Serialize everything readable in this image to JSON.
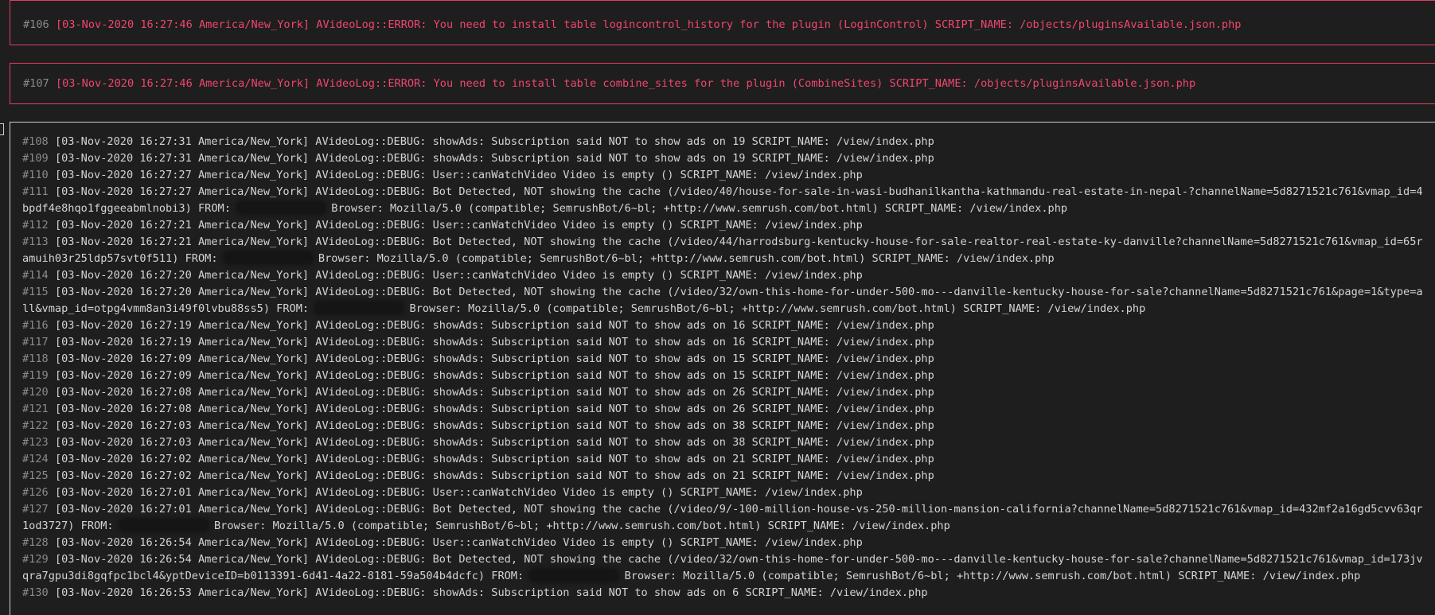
{
  "errors": [
    {
      "num": "#106",
      "text": "[03-Nov-2020 16:27:46 America/New_York] AVideoLog::ERROR: You need to install table logincontrol_history for the plugin (LoginControl) SCRIPT_NAME: /objects/pluginsAvailable.json.php"
    },
    {
      "num": "#107",
      "text": "[03-Nov-2020 16:27:46 America/New_York] AVideoLog::ERROR: You need to install table combine_sites for the plugin (CombineSites) SCRIPT_NAME: /objects/pluginsAvailable.json.php"
    }
  ],
  "debug_lines": [
    {
      "num": "#108",
      "text": "[03-Nov-2020 16:27:31 America/New_York] AVideoLog::DEBUG: showAds: Subscription said NOT to show ads on 19 SCRIPT_NAME: /view/index.php"
    },
    {
      "num": "#109",
      "text": "[03-Nov-2020 16:27:31 America/New_York] AVideoLog::DEBUG: showAds: Subscription said NOT to show ads on 19 SCRIPT_NAME: /view/index.php"
    },
    {
      "num": "#110",
      "text": "[03-Nov-2020 16:27:27 America/New_York] AVideoLog::DEBUG: User::canWatchVideo Video is empty () SCRIPT_NAME: /view/index.php"
    },
    {
      "num": "#111",
      "text": "[03-Nov-2020 16:27:27 America/New_York] AVideoLog::DEBUG: Bot Detected, NOT showing the cache (/video/40/house-for-sale-in-wasi-budhanilkantha-kathmandu-real-estate-in-nepal-?channelName=5d8271521c761&vmap_id=4bpdf4e8hqo1fggeeabmlnobi3) FROM:",
      "redacted": true,
      "text2": "Browser: Mozilla/5.0 (compatible; SemrushBot/6~bl; +http://www.semrush.com/bot.html) SCRIPT_NAME: /view/index.php"
    },
    {
      "num": "#112",
      "text": "[03-Nov-2020 16:27:21 America/New_York] AVideoLog::DEBUG: User::canWatchVideo Video is empty () SCRIPT_NAME: /view/index.php"
    },
    {
      "num": "#113",
      "text": "[03-Nov-2020 16:27:21 America/New_York] AVideoLog::DEBUG: Bot Detected, NOT showing the cache (/video/44/harrodsburg-kentucky-house-for-sale-realtor-real-estate-ky-danville?channelName=5d8271521c761&vmap_id=65ramuih03r25ldp57svt0f511) FROM:",
      "redacted": true,
      "text2": "Browser: Mozilla/5.0 (compatible; SemrushBot/6~bl; +http://www.semrush.com/bot.html) SCRIPT_NAME: /view/index.php"
    },
    {
      "num": "#114",
      "text": "[03-Nov-2020 16:27:20 America/New_York] AVideoLog::DEBUG: User::canWatchVideo Video is empty () SCRIPT_NAME: /view/index.php"
    },
    {
      "num": "#115",
      "text": "[03-Nov-2020 16:27:20 America/New_York] AVideoLog::DEBUG: Bot Detected, NOT showing the cache (/video/32/own-this-home-for-under-500-mo---danville-kentucky-house-for-sale?channelName=5d8271521c761&page=1&type=all&vmap_id=otpg4vmm8an3i49f0lvbu88ss5) FROM:",
      "redacted": true,
      "text2": "Browser: Mozilla/5.0 (compatible; SemrushBot/6~bl; +http://www.semrush.com/bot.html) SCRIPT_NAME: /view/index.php"
    },
    {
      "num": "#116",
      "text": "[03-Nov-2020 16:27:19 America/New_York] AVideoLog::DEBUG: showAds: Subscription said NOT to show ads on 16 SCRIPT_NAME: /view/index.php"
    },
    {
      "num": "#117",
      "text": "[03-Nov-2020 16:27:19 America/New_York] AVideoLog::DEBUG: showAds: Subscription said NOT to show ads on 16 SCRIPT_NAME: /view/index.php"
    },
    {
      "num": "#118",
      "text": "[03-Nov-2020 16:27:09 America/New_York] AVideoLog::DEBUG: showAds: Subscription said NOT to show ads on 15 SCRIPT_NAME: /view/index.php"
    },
    {
      "num": "#119",
      "text": "[03-Nov-2020 16:27:09 America/New_York] AVideoLog::DEBUG: showAds: Subscription said NOT to show ads on 15 SCRIPT_NAME: /view/index.php"
    },
    {
      "num": "#120",
      "text": "[03-Nov-2020 16:27:08 America/New_York] AVideoLog::DEBUG: showAds: Subscription said NOT to show ads on 26 SCRIPT_NAME: /view/index.php"
    },
    {
      "num": "#121",
      "text": "[03-Nov-2020 16:27:08 America/New_York] AVideoLog::DEBUG: showAds: Subscription said NOT to show ads on 26 SCRIPT_NAME: /view/index.php"
    },
    {
      "num": "#122",
      "text": "[03-Nov-2020 16:27:03 America/New_York] AVideoLog::DEBUG: showAds: Subscription said NOT to show ads on 38 SCRIPT_NAME: /view/index.php"
    },
    {
      "num": "#123",
      "text": "[03-Nov-2020 16:27:03 America/New_York] AVideoLog::DEBUG: showAds: Subscription said NOT to show ads on 38 SCRIPT_NAME: /view/index.php"
    },
    {
      "num": "#124",
      "text": "[03-Nov-2020 16:27:02 America/New_York] AVideoLog::DEBUG: showAds: Subscription said NOT to show ads on 21 SCRIPT_NAME: /view/index.php"
    },
    {
      "num": "#125",
      "text": "[03-Nov-2020 16:27:02 America/New_York] AVideoLog::DEBUG: showAds: Subscription said NOT to show ads on 21 SCRIPT_NAME: /view/index.php"
    },
    {
      "num": "#126",
      "text": "[03-Nov-2020 16:27:01 America/New_York] AVideoLog::DEBUG: User::canWatchVideo Video is empty () SCRIPT_NAME: /view/index.php"
    },
    {
      "num": "#127",
      "text": "[03-Nov-2020 16:27:01 America/New_York] AVideoLog::DEBUG: Bot Detected, NOT showing the cache (/video/9/-100-million-house-vs-250-million-mansion-california?channelName=5d8271521c761&vmap_id=432mf2a16gd5cvv63qr1od3727) FROM:",
      "redacted": true,
      "text2": "Browser: Mozilla/5.0 (compatible; SemrushBot/6~bl; +http://www.semrush.com/bot.html) SCRIPT_NAME: /view/index.php"
    },
    {
      "num": "#128",
      "text": "[03-Nov-2020 16:26:54 America/New_York] AVideoLog::DEBUG: User::canWatchVideo Video is empty () SCRIPT_NAME: /view/index.php"
    },
    {
      "num": "#129",
      "text": "[03-Nov-2020 16:26:54 America/New_York] AVideoLog::DEBUG: Bot Detected, NOT showing the cache (/video/32/own-this-home-for-under-500-mo---danville-kentucky-house-for-sale?channelName=5d8271521c761&vmap_id=173jvqra7gpu3di8gqfpc1bcl4&yptDeviceID=b0113391-6d41-4a22-8181-59a504b4dcfc) FROM:",
      "redacted": true,
      "text2": "Browser: Mozilla/5.0 (compatible; SemrushBot/6~bl; +http://www.semrush.com/bot.html) SCRIPT_NAME: /view/index.php"
    },
    {
      "num": "#130",
      "text": "[03-Nov-2020 16:26:53 America/New_York] AVideoLog::DEBUG: showAds: Subscription said NOT to show ads on 6 SCRIPT_NAME: /view/index.php"
    }
  ]
}
